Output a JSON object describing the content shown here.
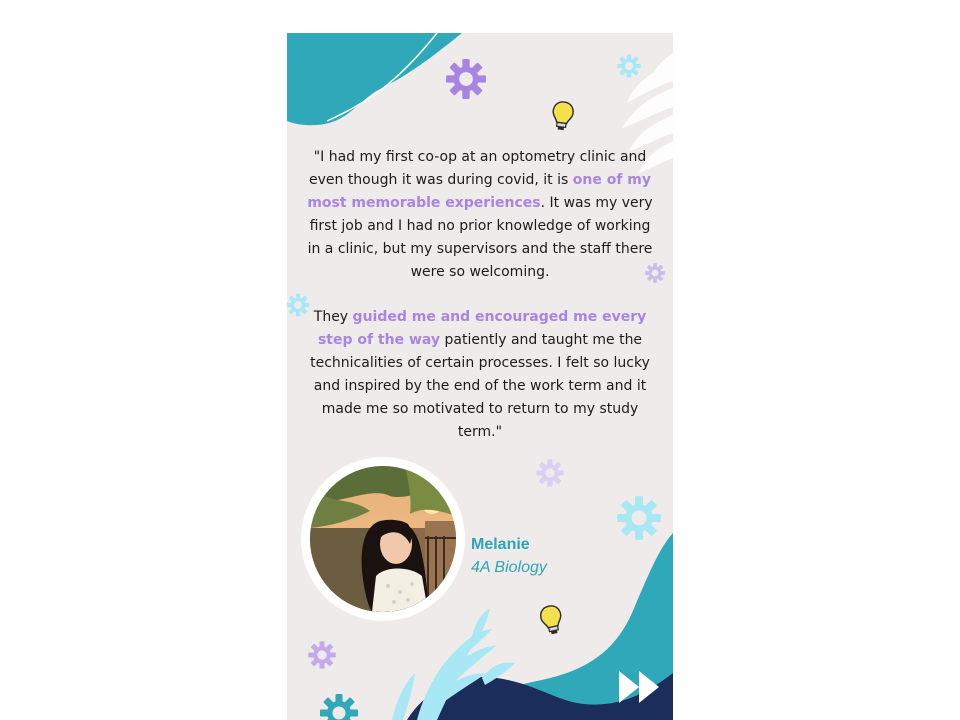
{
  "testimonial": {
    "paragraph1": {
      "before": "\"I had my first co-op at an optometry clinic and even though it was during covid, it is ",
      "highlight": "one of my most memorable experiences",
      "after": ". It was my very first job and I had no prior knowledge of working in a clinic, but my supervisors and the staff there were so welcoming."
    },
    "paragraph2": {
      "before": "They ",
      "highlight": "guided me and encouraged me every step of the way",
      "after": " patiently and taught me the technicalities of certain processes. I felt so lucky and inspired by the end of the work term and it made me so motivated to return to my study term.\""
    }
  },
  "student": {
    "name": "Melanie",
    "program": "4A Biology"
  },
  "icons": {
    "gear": "gear-icon",
    "bulb": "lightbulb-icon",
    "next": "fast-forward-icon",
    "leaf": "leaf-icon"
  },
  "colors": {
    "background": "#efebea",
    "teal": "#2fa8b9",
    "navy": "#1b2d5a",
    "purple": "#a885e2",
    "light_cyan": "#a8e8f5",
    "yellow": "#f4e04d"
  }
}
